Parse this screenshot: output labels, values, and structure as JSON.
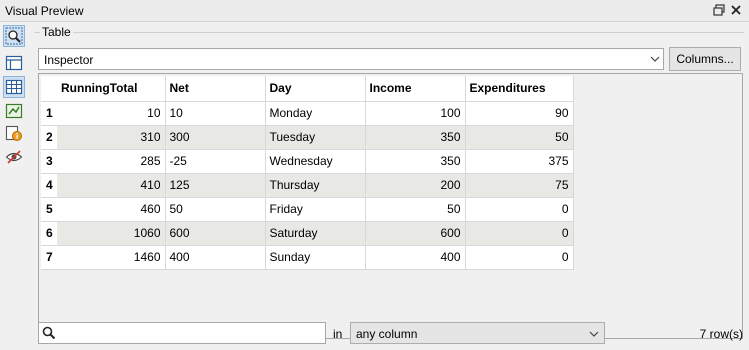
{
  "window": {
    "title": "Visual Preview"
  },
  "toolbar": {
    "tools": [
      "inspector-icon",
      "layout-icon",
      "table-icon",
      "graphics-icon",
      "info-icon",
      "hide-icon"
    ]
  },
  "panel": {
    "group_label": "Table",
    "selector_value": "Inspector",
    "columns_button": "Columns..."
  },
  "table": {
    "columns": [
      "RunningTotal",
      "Net",
      "Day",
      "Income",
      "Expenditures"
    ],
    "rows": [
      {
        "num": "1",
        "running_total": "10",
        "net": "10",
        "day": "Monday",
        "income": "100",
        "expenditures": "90"
      },
      {
        "num": "2",
        "running_total": "310",
        "net": "300",
        "day": "Tuesday",
        "income": "350",
        "expenditures": "50"
      },
      {
        "num": "3",
        "running_total": "285",
        "net": "-25",
        "day": "Wednesday",
        "income": "350",
        "expenditures": "375"
      },
      {
        "num": "4",
        "running_total": "410",
        "net": "125",
        "day": "Thursday",
        "income": "200",
        "expenditures": "75"
      },
      {
        "num": "5",
        "running_total": "460",
        "net": "50",
        "day": "Friday",
        "income": "50",
        "expenditures": "0"
      },
      {
        "num": "6",
        "running_total": "1060",
        "net": "600",
        "day": "Saturday",
        "income": "600",
        "expenditures": "0"
      },
      {
        "num": "7",
        "running_total": "1460",
        "net": "400",
        "day": "Sunday",
        "income": "400",
        "expenditures": "0"
      }
    ]
  },
  "search": {
    "value": "",
    "in_label": "in",
    "column_scope": "any column",
    "row_count": "7 row(s)"
  }
}
